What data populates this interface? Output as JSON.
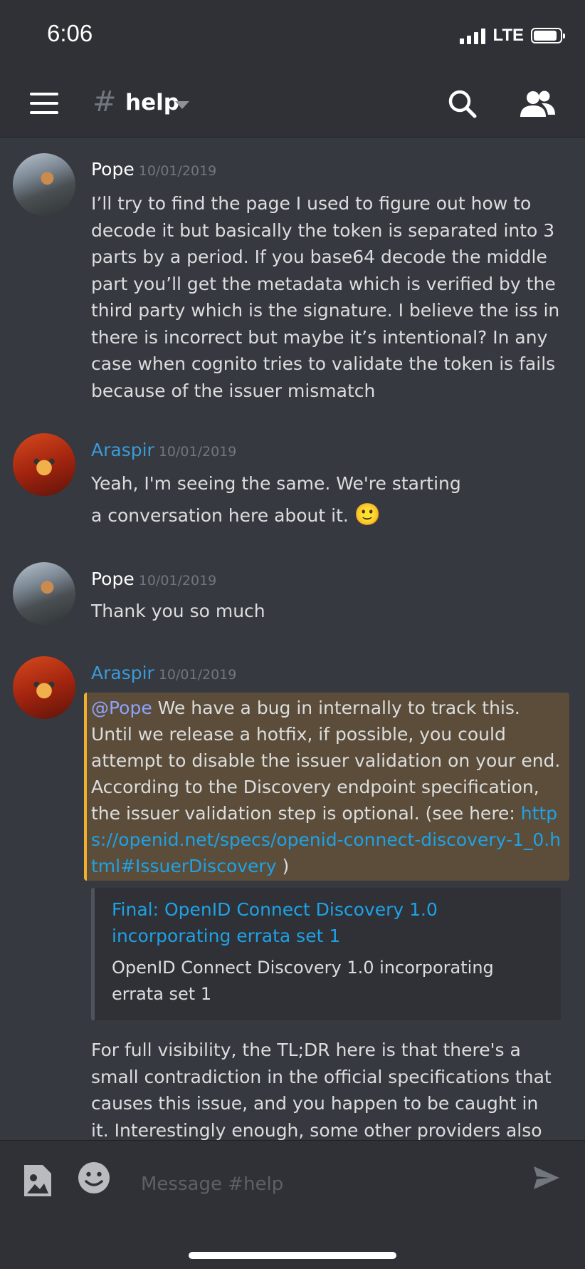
{
  "status": {
    "time": "6:06",
    "network": "LTE"
  },
  "header": {
    "hash": "#",
    "channel": "help"
  },
  "messages": [
    {
      "author": "Pope",
      "timestamp": "10/01/2019",
      "text": "I’ll try to find the page I used to figure out how to decode it but basically the token is separated into 3 parts by a period. If you base64 decode the middle part you’ll get the metadata which is verified by the third party which is the signature. I believe the iss in there is incorrect but maybe it’s intentional? In any case when cognito tries to validate the token is fails because of the issuer mismatch"
    },
    {
      "author": "Araspir",
      "timestamp": "10/01/2019",
      "text": "Yeah, I'm seeing the same. We're starting a conversation here about it.",
      "emoji": "🙂"
    },
    {
      "author": "Pope",
      "timestamp": "10/01/2019",
      "text": "Thank you so much"
    },
    {
      "author": "Araspir",
      "timestamp": "10/01/2019",
      "mention": "@Pope",
      "text": " We have a bug in internally to track this. Until we release a hotfix, if possible, you could attempt to disable the issuer validation on your end. According to the Discovery endpoint specification, the issuer validation step is optional. (see here: ",
      "link": "https://openid.net/specs/openid-connect-discovery-1_0.html#IssuerDiscovery",
      "after_link": " )",
      "embed": {
        "title": "Final: OpenID Connect Discovery 1.0 incorporating errata set 1",
        "description": "OpenID Connect Discovery 1.0 incorporating errata set 1"
      },
      "followup": "For full visibility, the TL;DR here is that there's a small contradiction in the official specifications that causes this issue, and you happen to be caught in it. Interestingly enough, some other providers also have"
    }
  ],
  "composer": {
    "placeholder": "Message #help"
  },
  "icons": {
    "hamburger": "menu-icon",
    "search": "search-icon",
    "members": "members-icon",
    "image": "image-upload-icon",
    "emoji": "emoji-icon",
    "send": "send-icon"
  }
}
